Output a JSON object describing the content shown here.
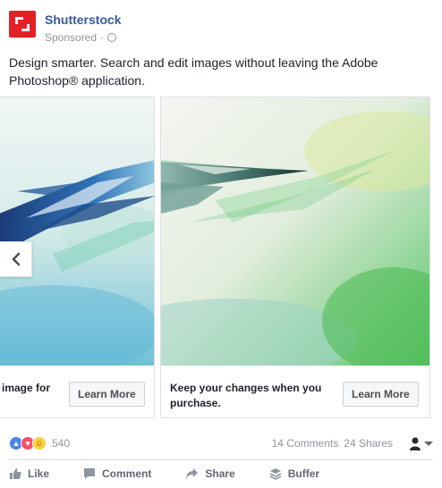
{
  "post": {
    "page_name": "Shutterstock",
    "sponsored_label": "Sponsored",
    "sponsored_separator": "·",
    "privacy_icon": "globe-icon",
    "description": "Design smarter. Search and edit images without leaving the Adobe Photoshop® application."
  },
  "carousel": {
    "cards": [
      {
        "caption": "image for",
        "button": "Learn More"
      },
      {
        "caption": "Keep your changes when you purchase.",
        "button": "Learn More"
      }
    ],
    "prev_icon": "chevron-left-icon"
  },
  "stats": {
    "reaction_icons": [
      "like-reaction-icon",
      "love-reaction-icon",
      "haha-reaction-icon"
    ],
    "reaction_count": "540",
    "comments": "14 Comments",
    "shares": "24 Shares"
  },
  "actions": [
    {
      "label": "Like",
      "icon": "thumbs-up-icon"
    },
    {
      "label": "Comment",
      "icon": "comment-icon"
    },
    {
      "label": "Share",
      "icon": "share-icon"
    },
    {
      "label": "Buffer",
      "icon": "buffer-icon"
    }
  ],
  "colors": {
    "brand_red": "#e41f26",
    "link_blue": "#365899",
    "secondary_text": "#90949c"
  }
}
